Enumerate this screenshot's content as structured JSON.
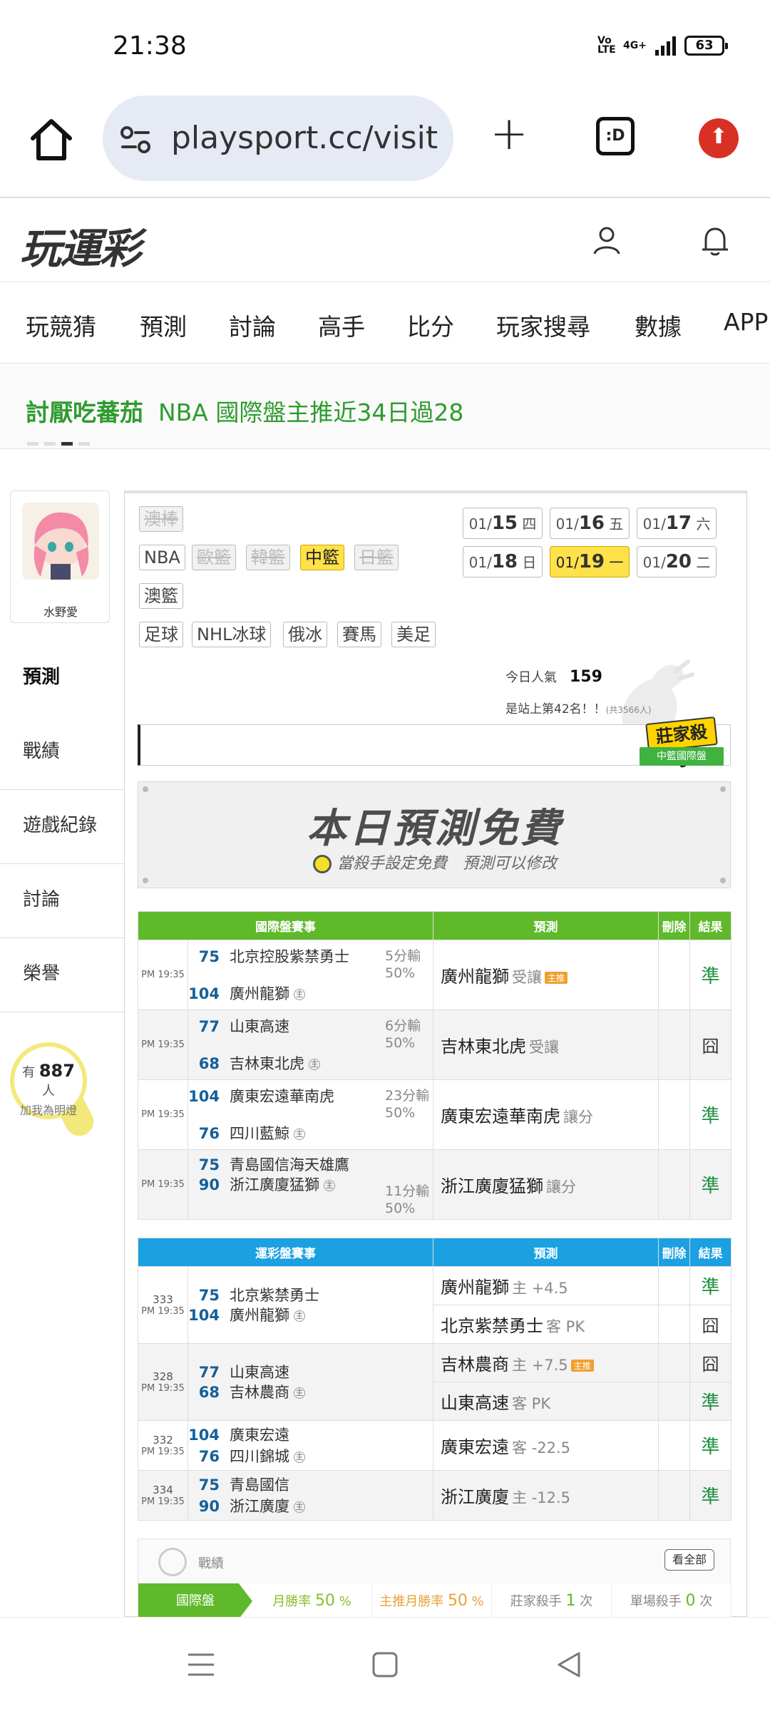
{
  "status": {
    "time": "21:38",
    "volte": "Vo LTE",
    "network": "4G+",
    "battery": "63"
  },
  "browser": {
    "url": "playsport.cc/visit",
    "tabs_label": ":D"
  },
  "site": {
    "logo": "玩運彩",
    "nav": [
      "玩競猜",
      "預測",
      "討論",
      "高手",
      "比分",
      "玩家搜尋",
      "數據",
      "APP"
    ]
  },
  "marquee": {
    "user": "討厭吃蕃茄",
    "text": "NBA 國際盤主推近34日過28"
  },
  "profile": {
    "name": "水野愛",
    "menu": [
      "預測",
      "戰績",
      "遊戲紀錄",
      "討論",
      "榮譽"
    ],
    "fans_prefix": "有",
    "fans_count": "887",
    "fans_suffix": "人",
    "fans_cta": "加我為明燈"
  },
  "filters": {
    "row0": [
      {
        "label": "澳棒",
        "state": "off"
      }
    ],
    "row1": [
      {
        "label": "NBA",
        "state": "on"
      },
      {
        "label": "歐籃",
        "state": "off"
      },
      {
        "label": "韓籃",
        "state": "off"
      },
      {
        "label": "中籃",
        "state": "sel"
      },
      {
        "label": "日籃",
        "state": "off"
      }
    ],
    "row2": [
      {
        "label": "澳籃",
        "state": "on"
      }
    ],
    "row3": [
      {
        "label": "足球",
        "state": "on"
      },
      {
        "label": "NHL冰球",
        "state": "on"
      },
      {
        "label": "俄冰",
        "state": "on"
      },
      {
        "label": "賽馬",
        "state": "on"
      },
      {
        "label": "美足",
        "state": "on"
      }
    ]
  },
  "dates": [
    {
      "md": "01/",
      "d": "15",
      "w": "四",
      "sel": false
    },
    {
      "md": "01/",
      "d": "16",
      "w": "五",
      "sel": false
    },
    {
      "md": "01/",
      "d": "17",
      "w": "六",
      "sel": false
    },
    {
      "md": "01/",
      "d": "18",
      "w": "日",
      "sel": false
    },
    {
      "md": "01/",
      "d": "19",
      "w": "一",
      "sel": true
    },
    {
      "md": "01/",
      "d": "20",
      "w": "二",
      "sel": false
    }
  ],
  "popularity": {
    "label": "今日人氣",
    "value": "159",
    "rank": "是站上第42名！！",
    "rank_note": "(共3566人)"
  },
  "badge": {
    "top": "莊家殺手",
    "bottom": "中籃國際盤"
  },
  "banner": {
    "title": "本日預測免費",
    "sub": "當殺手設定免費　預測可以修改"
  },
  "intl_table": {
    "headers": [
      "國際盤賽事",
      "預測",
      "刪除",
      "結果"
    ],
    "rows": [
      {
        "time": "PM 19:35",
        "away_no": "75",
        "away": "北京控股紫禁勇士",
        "home_no": "104",
        "home": "廣州龍獅",
        "hc": "5分輸",
        "pct": "50%",
        "pick": "廣州龍獅",
        "side": "受讓",
        "tag": "主推",
        "result": "準"
      },
      {
        "time": "PM 19:35",
        "away_no": "77",
        "away": "山東高速",
        "home_no": "68",
        "home": "吉林東北虎",
        "hc": "6分輸",
        "pct": "50%",
        "pick": "吉林東北虎",
        "side": "受讓",
        "tag": "",
        "result": "囧"
      },
      {
        "time": "PM 19:35",
        "away_no": "104",
        "away": "廣東宏遠華南虎",
        "home_no": "76",
        "home": "四川藍鯨",
        "hc": "23分輸",
        "pct": "50%",
        "pick": "廣東宏遠華南虎",
        "side": "讓分",
        "tag": "",
        "result": "準"
      },
      {
        "time": "PM 19:35",
        "away_no": "75",
        "away": "青島國信海天雄鷹",
        "home_no": "90",
        "home": "浙江廣廈猛獅",
        "hc": "11分輸",
        "pct": "50%",
        "pick": "浙江廣廈猛獅",
        "side": "讓分",
        "tag": "",
        "result": "準"
      }
    ]
  },
  "local_table": {
    "headers": [
      "運彩盤賽事",
      "預測",
      "刪除",
      "結果"
    ],
    "rows": [
      {
        "no": "333",
        "time": "PM 19:35",
        "away_no": "75",
        "away": "北京紫禁勇士",
        "home_no": "104",
        "home": "廣州龍獅",
        "picks": [
          {
            "team": "廣州龍獅",
            "line": "主 +4.5",
            "tag": "",
            "result": "準"
          },
          {
            "team": "北京紫禁勇士",
            "line": "客 PK",
            "tag": "",
            "result": "囧"
          }
        ]
      },
      {
        "no": "328",
        "time": "PM 19:35",
        "away_no": "77",
        "away": "山東高速",
        "home_no": "68",
        "home": "吉林農商",
        "picks": [
          {
            "team": "吉林農商",
            "line": "主 +7.5",
            "tag": "主推",
            "result": "囧"
          },
          {
            "team": "山東高速",
            "line": "客 PK",
            "tag": "",
            "result": "準"
          }
        ]
      },
      {
        "no": "332",
        "time": "PM 19:35",
        "away_no": "104",
        "away": "廣東宏遠",
        "home_no": "76",
        "home": "四川錦城",
        "picks": [
          {
            "team": "廣東宏遠",
            "line": "客 -22.5",
            "tag": "",
            "result": "準"
          }
        ]
      },
      {
        "no": "334",
        "time": "PM 19:35",
        "away_no": "75",
        "away": "青島國信",
        "home_no": "90",
        "home": "浙江廣廈",
        "picks": [
          {
            "team": "浙江廣廈",
            "line": "主 -12.5",
            "tag": "",
            "result": "準"
          }
        ]
      }
    ]
  },
  "home_mark": "主",
  "record": {
    "label": "戰績",
    "view_all": "看全部",
    "tab": "國際盤",
    "monthly_label": "月勝率",
    "monthly": "50",
    "pct_unit": "%",
    "main_label": "主推月勝率",
    "main": "50",
    "killer_label": "莊家殺手",
    "killer": "1",
    "times_unit": "次",
    "single_label": "單場殺手",
    "single": "0"
  },
  "colors": {
    "green": "#5fb92b",
    "blue": "#1ba0e2",
    "yellow": "#ffe14a",
    "result_green": "#1d8f3f",
    "link_green": "#2e9b2e"
  }
}
